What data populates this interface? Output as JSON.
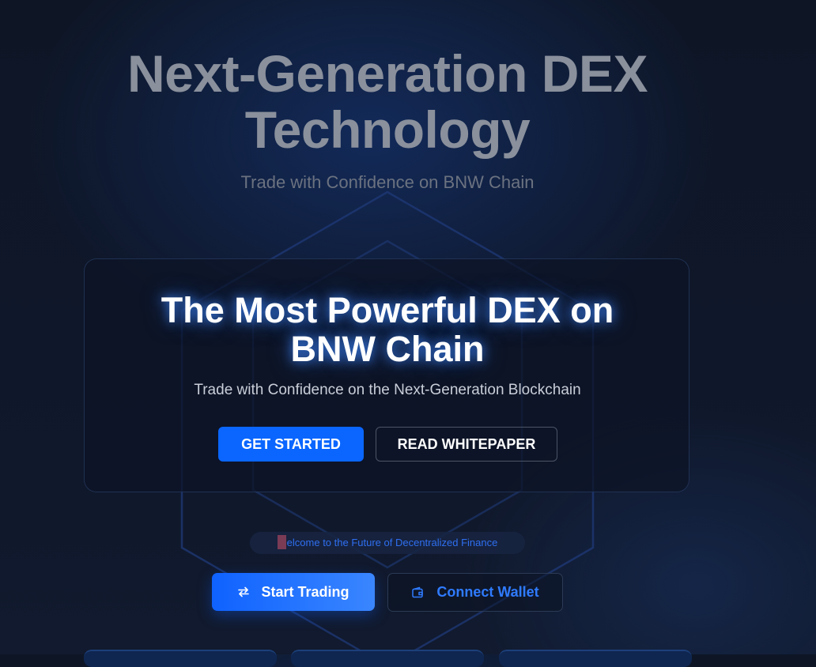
{
  "hero": {
    "title_line1": "Next-Generation DEX",
    "title_line2": "Technology",
    "subtitle": "Trade with Confidence on BNW Chain"
  },
  "card": {
    "title_line1": "The Most Powerful DEX on",
    "title_line2": "BNW Chain",
    "subtitle": "Trade with Confidence on the Next-Generation Blockchain",
    "primary_button": "GET STARTED",
    "secondary_button": "READ WHITEPAPER"
  },
  "welcome": {
    "text": "elcome to the Future of Decentralized Finance"
  },
  "actions": {
    "start_trading": "Start Trading",
    "start_trading_icon": "swap-arrows-icon",
    "connect_wallet": "Connect Wallet",
    "connect_wallet_icon": "wallet-icon"
  },
  "colors": {
    "background": "#0d1424",
    "accent": "#0a66ff",
    "accent_text": "#2f7bff",
    "hero_title": "#8a909c",
    "muted_text": "#6b7280"
  }
}
